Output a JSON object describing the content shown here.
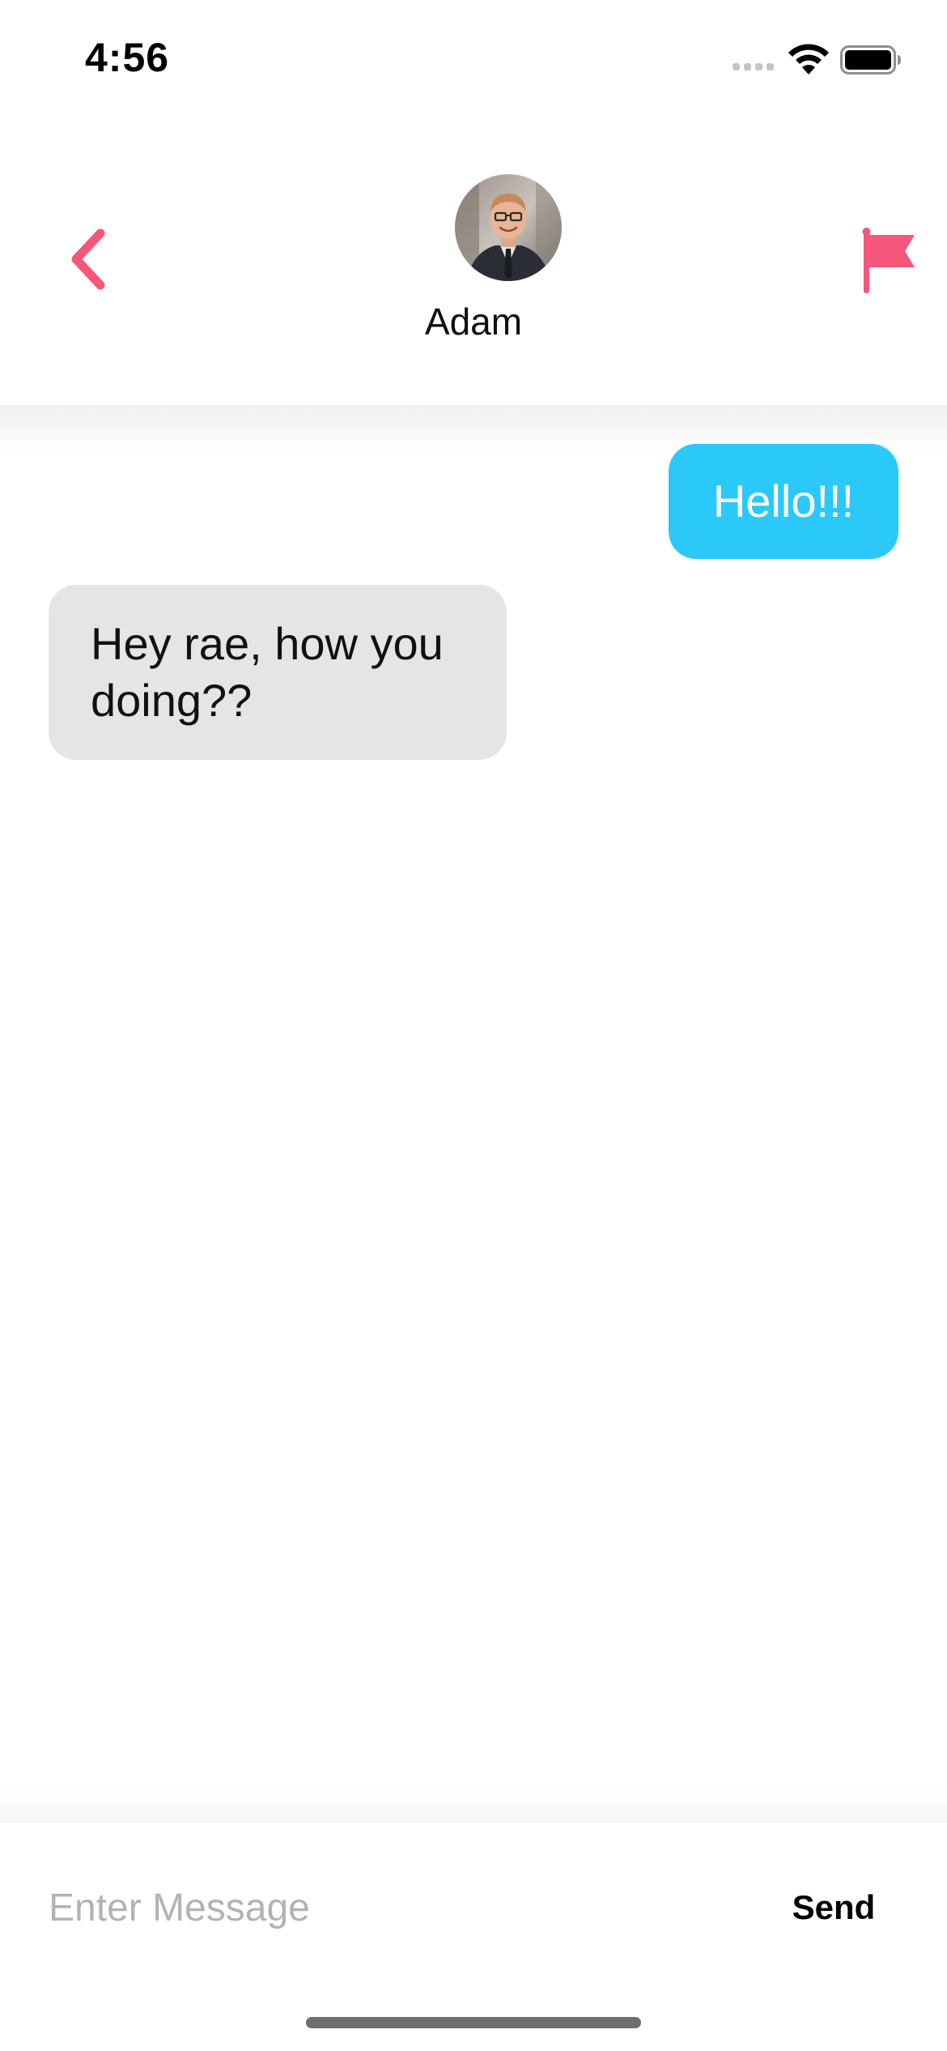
{
  "status_bar": {
    "time": "4:56",
    "signal_icon": "cellular-signal-icon",
    "wifi_icon": "wifi-icon",
    "battery_icon": "battery-icon"
  },
  "header": {
    "back_icon": "chevron-left-icon",
    "contact_name": "Adam",
    "avatar_icon": "contact-avatar",
    "flag_icon": "flag-icon"
  },
  "messages": [
    {
      "direction": "outgoing",
      "text": "Hello!!!"
    },
    {
      "direction": "incoming",
      "text": "Hey rae, how you doing??"
    }
  ],
  "composer": {
    "placeholder": "Enter Message",
    "value": "",
    "send_label": "Send"
  },
  "colors": {
    "accent": "#f5567a",
    "outgoing_bubble": "#2ac9fa",
    "incoming_bubble": "#e5e5e5",
    "placeholder": "#b3b3b3"
  }
}
